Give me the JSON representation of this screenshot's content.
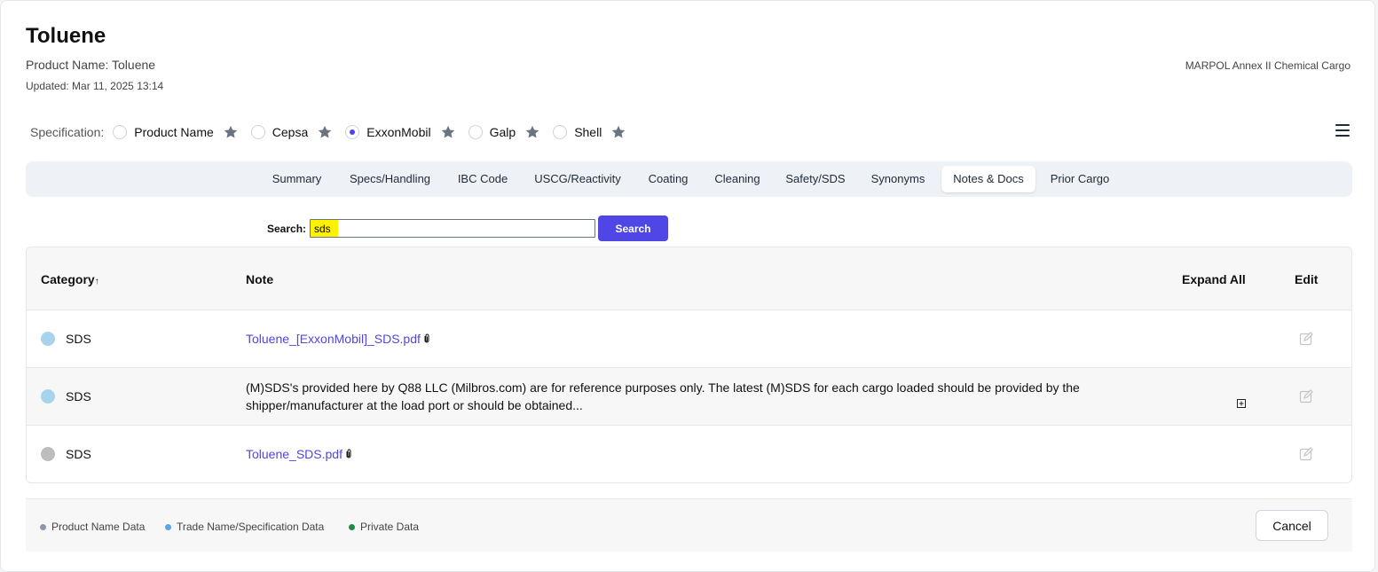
{
  "header": {
    "title": "Toluene",
    "product_name": "Product Name: Toluene",
    "updated": "Updated: Mar 11, 2025 13:14",
    "regulation": "MARPOL Annex II Chemical Cargo"
  },
  "specification": {
    "label": "Specification:",
    "selected": "ExxonMobil",
    "options": [
      {
        "name": "Product Name",
        "checked": false
      },
      {
        "name": "Cepsa",
        "checked": false
      },
      {
        "name": "ExxonMobil",
        "checked": true
      },
      {
        "name": "Galp",
        "checked": false
      },
      {
        "name": "Shell",
        "checked": false
      }
    ]
  },
  "tabs": {
    "items": [
      "Summary",
      "Specs/Handling",
      "IBC Code",
      "USCG/Reactivity",
      "Coating",
      "Cleaning",
      "Safety/SDS",
      "Synonyms",
      "Notes & Docs",
      "Prior Cargo"
    ],
    "active": "Notes & Docs"
  },
  "search": {
    "label": "Search:",
    "value": "sds",
    "button": "Search"
  },
  "table": {
    "headers": {
      "category": "Category",
      "sort_arrow": "↑",
      "note": "Note",
      "expand_all": "Expand All",
      "edit": "Edit"
    },
    "rows": [
      {
        "category": "SDS",
        "dot_color": "#a7d4ec",
        "note": "Toluene_[ExxonMobil]_SDS.pdf",
        "is_link": true
      },
      {
        "category": "SDS",
        "dot_color": "#a7d4ec",
        "note": "(M)SDS's provided here by Q88 LLC (Milbros.com) are for reference purposes only. The latest (M)SDS for each cargo loaded should be provided by the shipper/manufacturer at the load port or should be obtained...",
        "is_link": false
      },
      {
        "category": "SDS",
        "dot_color": "#bdbdbd",
        "note": "Toluene_SDS.pdf",
        "is_link": true
      }
    ]
  },
  "legend": [
    {
      "label": "Product Name Data",
      "color": "#8d97ab"
    },
    {
      "label": "Trade Name/Specification Data",
      "color": "#5da4e8"
    },
    {
      "label": "Private Data",
      "color": "#1f8a4c"
    }
  ],
  "footer": {
    "cancel_label": "Cancel"
  },
  "colors": {
    "accent": "#4f46e5",
    "highlight": "#fff200"
  }
}
